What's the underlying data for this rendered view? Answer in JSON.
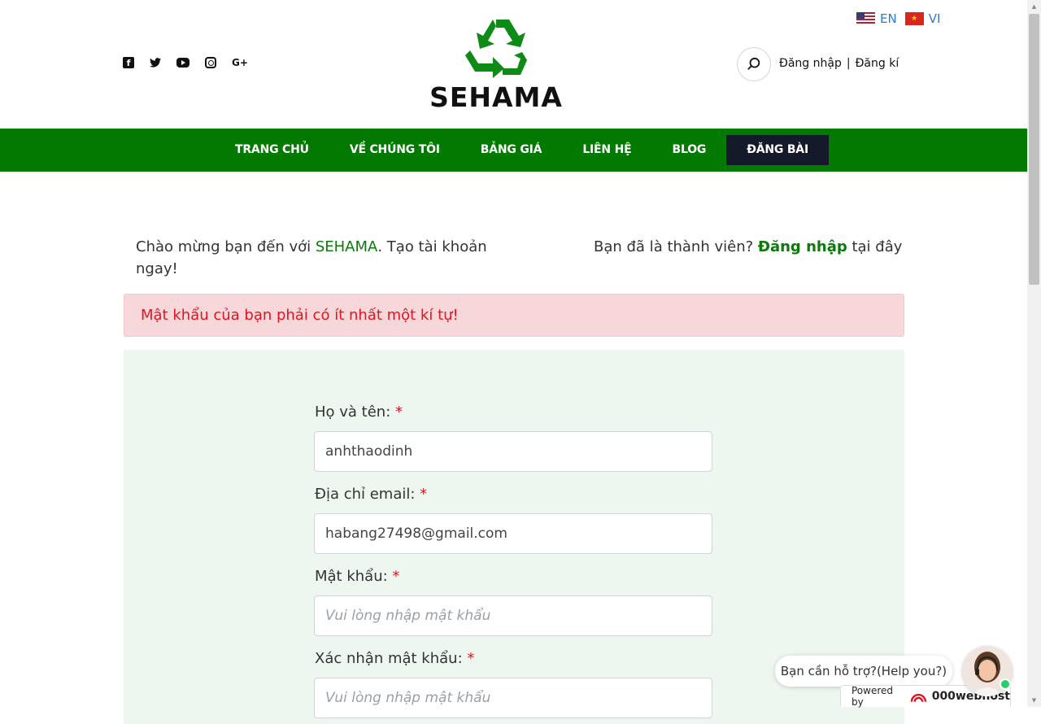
{
  "languages": [
    {
      "code": "EN",
      "flag": "us-flag-icon"
    },
    {
      "code": "VI",
      "flag": "vn-flag-icon"
    }
  ],
  "social": [
    "facebook-icon",
    "twitter-icon",
    "youtube-icon",
    "instagram-icon",
    "google-plus-icon"
  ],
  "logo": {
    "text": "SEHAMA"
  },
  "auth": {
    "login": "Đăng nhập",
    "separator": "|",
    "register": "Đăng kí"
  },
  "nav": {
    "items": [
      "TRANG CHỦ",
      "VỀ CHÚNG TÔI",
      "BẢNG GIÁ",
      "LIÊN HỆ",
      "BLOG",
      "ĐĂNG BÀI"
    ],
    "active_color": "#151a2a",
    "bar_color": "#027a02"
  },
  "intro": {
    "left_prefix": "Chào mừng bạn đến với ",
    "brand": "SEHAMA",
    "left_suffix": ". Tạo tài khoản ngay!",
    "right_prefix": "Bạn đã là thành viên? ",
    "right_link": "Đăng nhập",
    "right_suffix": " tại đây"
  },
  "alert": {
    "message": "Mật khẩu của bạn phải có ít nhất một kí tự!"
  },
  "form": {
    "fullname": {
      "label": "Họ và tên:",
      "required": "*",
      "value": "anhthaodinh"
    },
    "email": {
      "label": "Địa chỉ email:",
      "required": "*",
      "value": "habang27498@gmail.com"
    },
    "password": {
      "label": "Mật khẩu:",
      "required": "*",
      "placeholder": "Vui lòng nhập mật khẩu"
    },
    "confirm": {
      "label": "Xác nhận mật khẩu:",
      "required": "*",
      "placeholder": "Vui lòng nhập mật khẩu"
    }
  },
  "help": {
    "bubble": "Bạn cần hỗ trợ?(Help you?)",
    "powered_label": "Powered by",
    "powered_brand": "000webhost"
  }
}
